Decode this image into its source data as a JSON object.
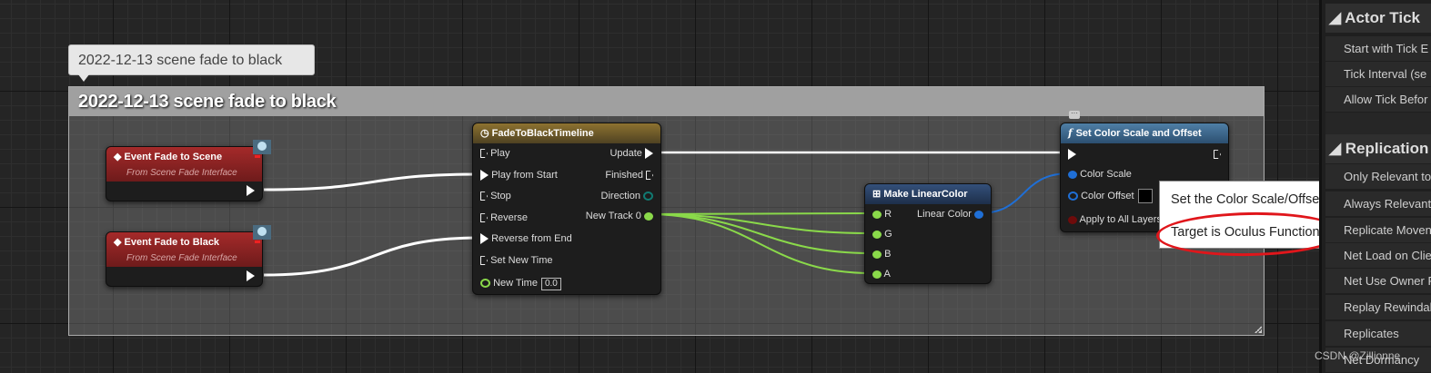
{
  "comment": {
    "bubble_text": "2022-12-13 scene fade to black",
    "header_title": "2022-12-13 scene fade to black"
  },
  "nodes": {
    "event_fade_to_scene": {
      "title": "Event Fade to Scene",
      "subtitle": "From Scene Fade Interface"
    },
    "event_fade_to_black": {
      "title": "Event Fade to Black",
      "subtitle": "From Scene Fade Interface"
    },
    "timeline": {
      "title": "FadeToBlackTimeline",
      "inputs": [
        "Play",
        "Play from Start",
        "Stop",
        "Reverse",
        "Reverse from End",
        "Set New Time"
      ],
      "new_time_label": "New Time",
      "new_time_value": "0.0",
      "outputs": [
        "Update",
        "Finished",
        "Direction",
        "New Track 0"
      ]
    },
    "make_linear_color": {
      "title": "Make LinearColor",
      "inputs": [
        "R",
        "G",
        "B",
        "A"
      ],
      "output": "Linear Color"
    },
    "set_color_scale": {
      "title": "Set Color Scale and Offset",
      "pins": [
        "Color Scale",
        "Color Offset",
        "Apply to All Layers"
      ]
    }
  },
  "tooltip": {
    "line1": "Set the Color Scale/Offset",
    "line2": "Target is Oculus Function Library"
  },
  "details_panel": {
    "section_actor_tick": "Actor Tick",
    "actor_tick_props": [
      "Start with Tick E",
      "Tick Interval (se",
      "Allow Tick Befor"
    ],
    "section_replication": "Replication",
    "replication_props": [
      "Only Relevant to",
      "Always Relevant",
      "Net Load on Clie",
      "Net Use Owner R",
      "Replay Rewindal",
      "Replicates",
      "Net Dormancy"
    ],
    "replication_props_partial": [
      "Replicate Moven"
    ]
  },
  "watermark": "CSDN @Zillionne",
  "colors": {
    "event_header": "#a52a2a",
    "timeline_header": "#8d7230",
    "function_header": "#4f7fa6",
    "float_pin": "#8ad94a",
    "struct_pin": "#1f6fd6",
    "annotation": "#e0161b"
  }
}
